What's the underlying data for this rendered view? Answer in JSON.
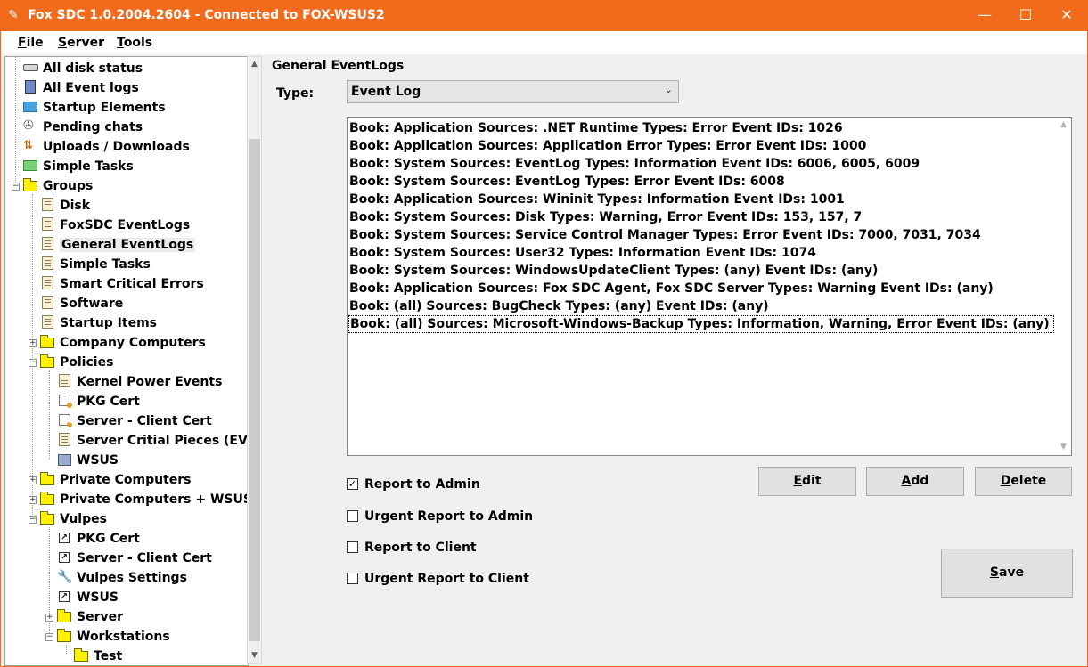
{
  "window": {
    "title": "Fox SDC 1.0.2004.2604 - Connected to FOX-WSUS2",
    "minimize_glyph": "—",
    "maximize_glyph": "☐",
    "close_glyph": "✕",
    "accent_color": "#f26b1d"
  },
  "menu": {
    "file": {
      "first": "F",
      "rest": "ile"
    },
    "server": {
      "first": "S",
      "rest": "erver"
    },
    "tools": {
      "first": "T",
      "rest": "ools"
    }
  },
  "tree": {
    "items": [
      {
        "label": "All disk status",
        "icon": "disk-icon"
      },
      {
        "label": "All Event logs",
        "icon": "event-log-icon"
      },
      {
        "label": "Startup Elements",
        "icon": "startup-icon"
      },
      {
        "label": "Pending chats",
        "icon": "chat-icon"
      },
      {
        "label": "Uploads / Downloads",
        "icon": "upload-download-icon"
      },
      {
        "label": "Simple Tasks",
        "icon": "tasks-icon"
      },
      {
        "label": "Groups",
        "icon": "folder-icon"
      },
      {
        "label": "Disk",
        "icon": "policy-document-icon"
      },
      {
        "label": "FoxSDC EventLogs",
        "icon": "policy-document-icon"
      },
      {
        "label": "General EventLogs",
        "icon": "policy-document-icon"
      },
      {
        "label": "Simple Tasks",
        "icon": "policy-document-icon"
      },
      {
        "label": "Smart Critical Errors",
        "icon": "policy-document-icon"
      },
      {
        "label": "Software",
        "icon": "policy-document-icon"
      },
      {
        "label": "Startup Items",
        "icon": "policy-document-icon"
      },
      {
        "label": "Company Computers",
        "icon": "folder-icon"
      },
      {
        "label": "Policies",
        "icon": "folder-icon"
      },
      {
        "label": "Kernel Power Events",
        "icon": "policy-document-icon"
      },
      {
        "label": "PKG Cert",
        "icon": "certificate-icon"
      },
      {
        "label": "Server - Client Cert",
        "icon": "certificate-icon"
      },
      {
        "label": "Server Critial Pieces (EVT)",
        "icon": "policy-document-icon"
      },
      {
        "label": "WSUS",
        "icon": "wsus-icon"
      },
      {
        "label": "Private Computers",
        "icon": "folder-icon"
      },
      {
        "label": "Private Computers + WSUS",
        "icon": "folder-icon"
      },
      {
        "label": "Vulpes",
        "icon": "folder-icon"
      },
      {
        "label": "PKG Cert",
        "icon": "shortcut-icon"
      },
      {
        "label": "Server - Client Cert",
        "icon": "shortcut-icon"
      },
      {
        "label": "Vulpes Settings",
        "icon": "wrench-icon"
      },
      {
        "label": "WSUS",
        "icon": "shortcut-icon"
      },
      {
        "label": "Server",
        "icon": "folder-icon"
      },
      {
        "label": "Workstations",
        "icon": "folder-icon"
      },
      {
        "label": "Test",
        "icon": "folder-icon"
      }
    ],
    "selected_label": "General EventLogs"
  },
  "panel": {
    "title": "General EventLogs",
    "type_label": "Type:",
    "type_value": "Event Log",
    "entries": [
      "Book: Application Sources: .NET Runtime Types:  Error Event IDs: 1026",
      "Book: Application Sources: Application Error Types:  Error Event IDs: 1000",
      "Book: System Sources: EventLog Types:  Information Event IDs: 6006, 6005, 6009",
      "Book: System Sources: EventLog Types:  Error Event IDs: 6008",
      "Book: Application Sources: Wininit Types:  Information Event IDs: 1001",
      "Book: System Sources: Disk Types:  Warning,  Error Event IDs: 153, 157, 7",
      "Book: System Sources: Service Control Manager Types:  Error Event IDs: 7000, 7031, 7034",
      "Book: System Sources: User32 Types:  Information Event IDs: 1074",
      "Book: System Sources: WindowsUpdateClient Types: (any) Event IDs: (any)",
      "Book: Application Sources: Fox SDC Agent, Fox SDC Server Types:  Warning Event IDs: (any)",
      "Book: (all) Sources: BugCheck Types: (any) Event IDs: (any)",
      "Book: (all) Sources: Microsoft-Windows-Backup Types:  Information,  Warning,  Error Event IDs: (any)"
    ],
    "selected_entry_index": 11,
    "checkboxes": [
      {
        "label": "Report to Admin",
        "checked": true
      },
      {
        "label": "Urgent Report to Admin",
        "checked": false
      },
      {
        "label": "Report to Client",
        "checked": false
      },
      {
        "label": "Urgent Report to Client",
        "checked": false
      }
    ],
    "buttons": {
      "edit": {
        "first": "E",
        "rest": "dit"
      },
      "add": {
        "first": "A",
        "rest": "dd"
      },
      "delete": {
        "first": "D",
        "rest": "elete"
      },
      "save": {
        "first": "S",
        "rest": "ave"
      }
    }
  }
}
